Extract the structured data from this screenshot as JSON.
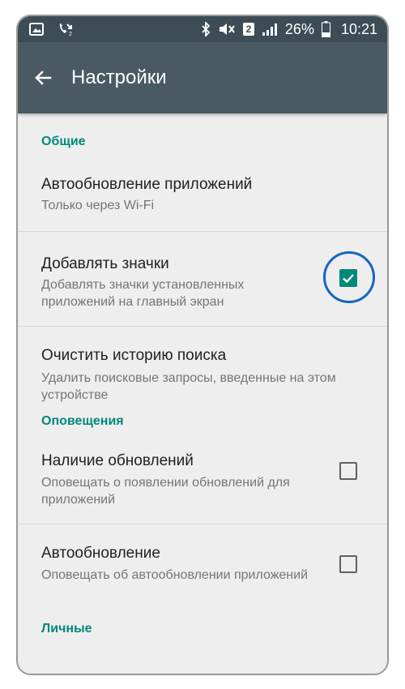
{
  "status_bar": {
    "battery": "26%",
    "time": "10:21",
    "sim_slot": "2"
  },
  "app_bar": {
    "title": "Настройки"
  },
  "sections": {
    "general": {
      "header": "Общие",
      "auto_update": {
        "title": "Автообновление приложений",
        "summary": "Только через Wi-Fi"
      },
      "add_icons": {
        "title": "Добавлять значки",
        "summary": "Добавлять значки установленных приложений на главный экран",
        "checked": true
      },
      "clear_history": {
        "title": "Очистить историю поиска",
        "summary": "Удалить поисковые запросы, введенные на этом устройстве"
      }
    },
    "notifications": {
      "header": "Оповещения",
      "updates_available": {
        "title": "Наличие обновлений",
        "summary": "Оповещать о появлении обновлений для приложений",
        "checked": false
      },
      "auto_update_notice": {
        "title": "Автообновление",
        "summary": "Оповещать об автообновлении приложений",
        "checked": false
      }
    },
    "personal": {
      "header": "Личные"
    }
  },
  "colors": {
    "accent": "#00897b",
    "toolbar": "#4a5a63",
    "status_bar": "#3d4d56",
    "highlight_ring": "#1565c0"
  }
}
